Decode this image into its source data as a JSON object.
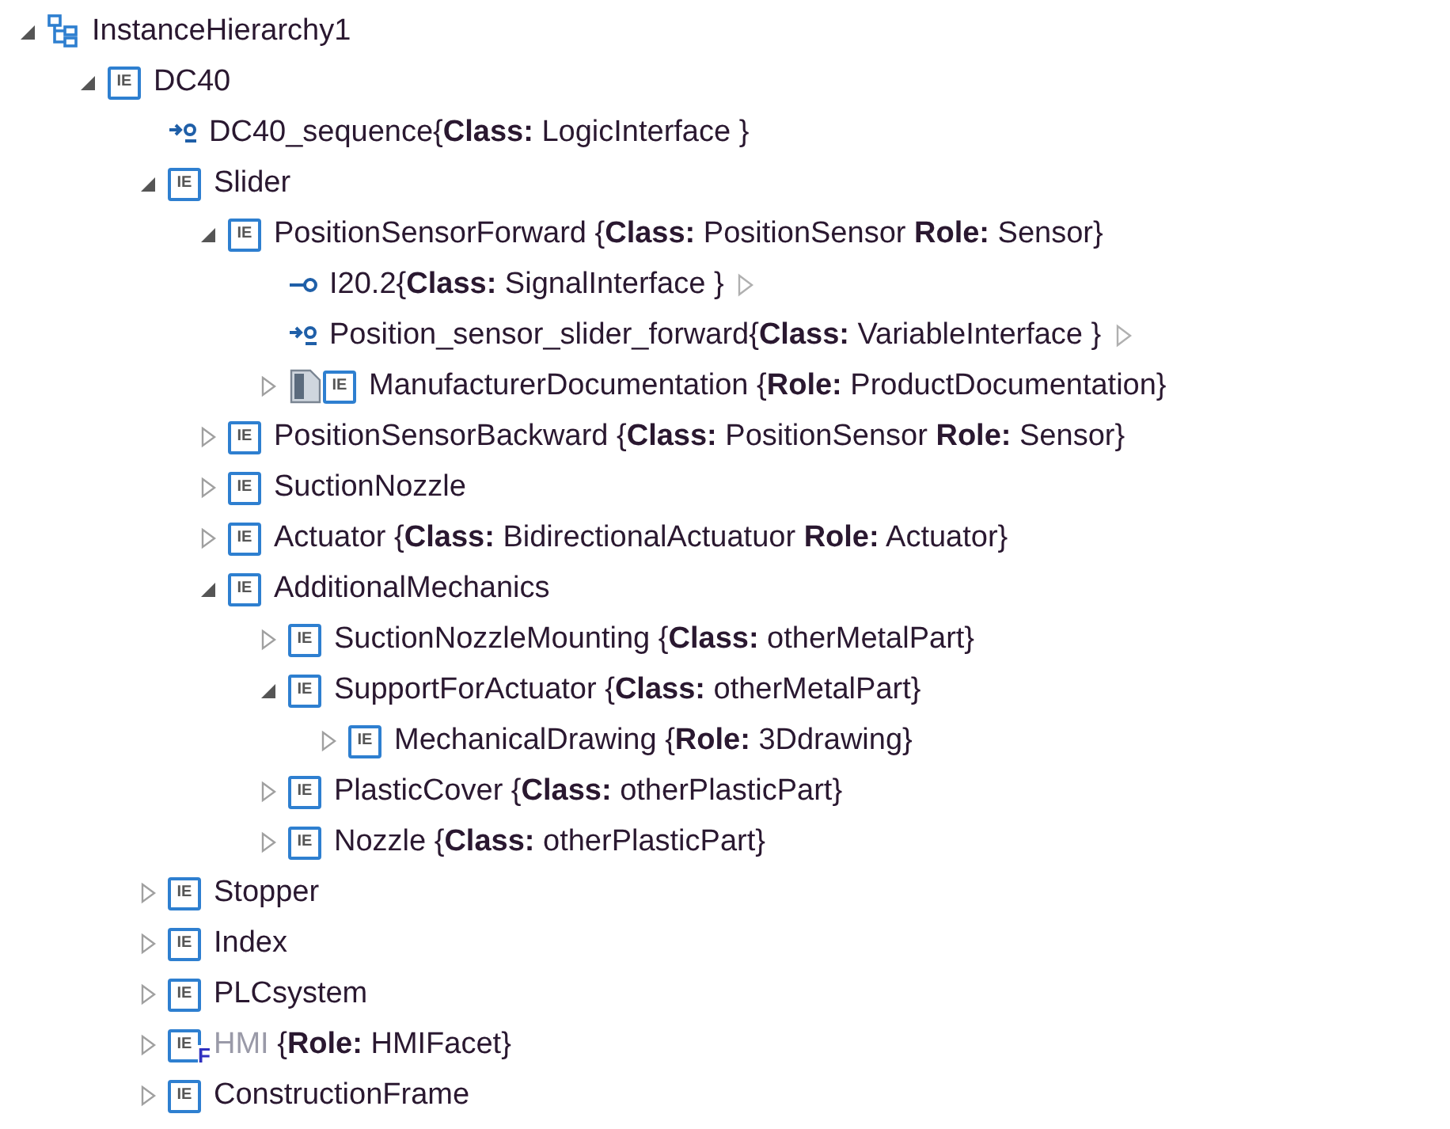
{
  "tree": [
    {
      "kind": "hierarchy",
      "name": "InstanceHierarchy1",
      "expanded": true,
      "children": [
        {
          "kind": "element",
          "icon_label": "IE",
          "name": "DC40",
          "expanded": true,
          "children": [
            {
              "kind": "logic-interface",
              "name": "DC40_sequence",
              "detail": "{**Class:** LogicInterface }"
            },
            {
              "kind": "element",
              "icon_label": "IE",
              "name": "Slider",
              "expanded": true,
              "children": [
                {
                  "kind": "element",
                  "icon_label": "IE",
                  "name": "PositionSensorForward",
                  "detail": " {**Class:** PositionSensor **Role:**  Sensor}",
                  "expanded": true,
                  "children": [
                    {
                      "kind": "signal-interface",
                      "name": "I20.2",
                      "detail": "{**Class:** SignalInterface }",
                      "linked": true
                    },
                    {
                      "kind": "logic-interface",
                      "name": "Position_sensor_slider_forward",
                      "detail": "{**Class:** VariableInterface }",
                      "linked": true
                    },
                    {
                      "kind": "document",
                      "icon_label": "IE",
                      "name": "ManufacturerDocumentation",
                      "detail": " {**Role:**  ProductDocumentation}",
                      "expanded": false
                    }
                  ]
                },
                {
                  "kind": "element",
                  "icon_label": "IE",
                  "name": "PositionSensorBackward",
                  "detail": " {**Class:** PositionSensor **Role:**  Sensor}",
                  "expanded": false
                },
                {
                  "kind": "element",
                  "icon_label": "IE",
                  "name": "SuctionNozzle",
                  "expanded": false
                },
                {
                  "kind": "element",
                  "icon_label": "IE",
                  "name": "Actuator",
                  "detail": " {**Class:** BidirectionalActuatuor **Role:**  Actuator}",
                  "expanded": false
                },
                {
                  "kind": "element",
                  "icon_label": "IE",
                  "name": "AdditionalMechanics",
                  "expanded": true,
                  "children": [
                    {
                      "kind": "element",
                      "icon_label": "IE",
                      "name": "SuctionNozzleMounting",
                      "detail": " {**Class:** otherMetalPart}",
                      "expanded": false
                    },
                    {
                      "kind": "element",
                      "icon_label": "IE",
                      "name": "SupportForActuator",
                      "detail": " {**Class:** otherMetalPart}",
                      "expanded": true,
                      "children": [
                        {
                          "kind": "element",
                          "icon_label": "IE",
                          "name": "MechanicalDrawing",
                          "detail": " {**Role:**  3Ddrawing}",
                          "expanded": false
                        }
                      ]
                    },
                    {
                      "kind": "element",
                      "icon_label": "IE",
                      "name": "PlasticCover",
                      "detail": " {**Class:** otherPlasticPart}",
                      "expanded": false
                    },
                    {
                      "kind": "element",
                      "icon_label": "IE",
                      "name": "Nozzle",
                      "detail": " {**Class:** otherPlasticPart}",
                      "expanded": false
                    }
                  ]
                }
              ]
            },
            {
              "kind": "element",
              "icon_label": "IE",
              "name": "Stopper",
              "expanded": false
            },
            {
              "kind": "element",
              "icon_label": "IE",
              "name": "Index",
              "expanded": false
            },
            {
              "kind": "element",
              "icon_label": "IE",
              "name": "PLCsystem",
              "expanded": false
            },
            {
              "kind": "element",
              "icon_label": "IE",
              "facet_mark": "F",
              "name": "HMI",
              "detail": " {**Role:**  HMIFacet}",
              "expanded": false,
              "disabled": true
            },
            {
              "kind": "element",
              "icon_label": "IE",
              "name": "ConstructionFrame",
              "expanded": false
            }
          ]
        }
      ]
    }
  ]
}
